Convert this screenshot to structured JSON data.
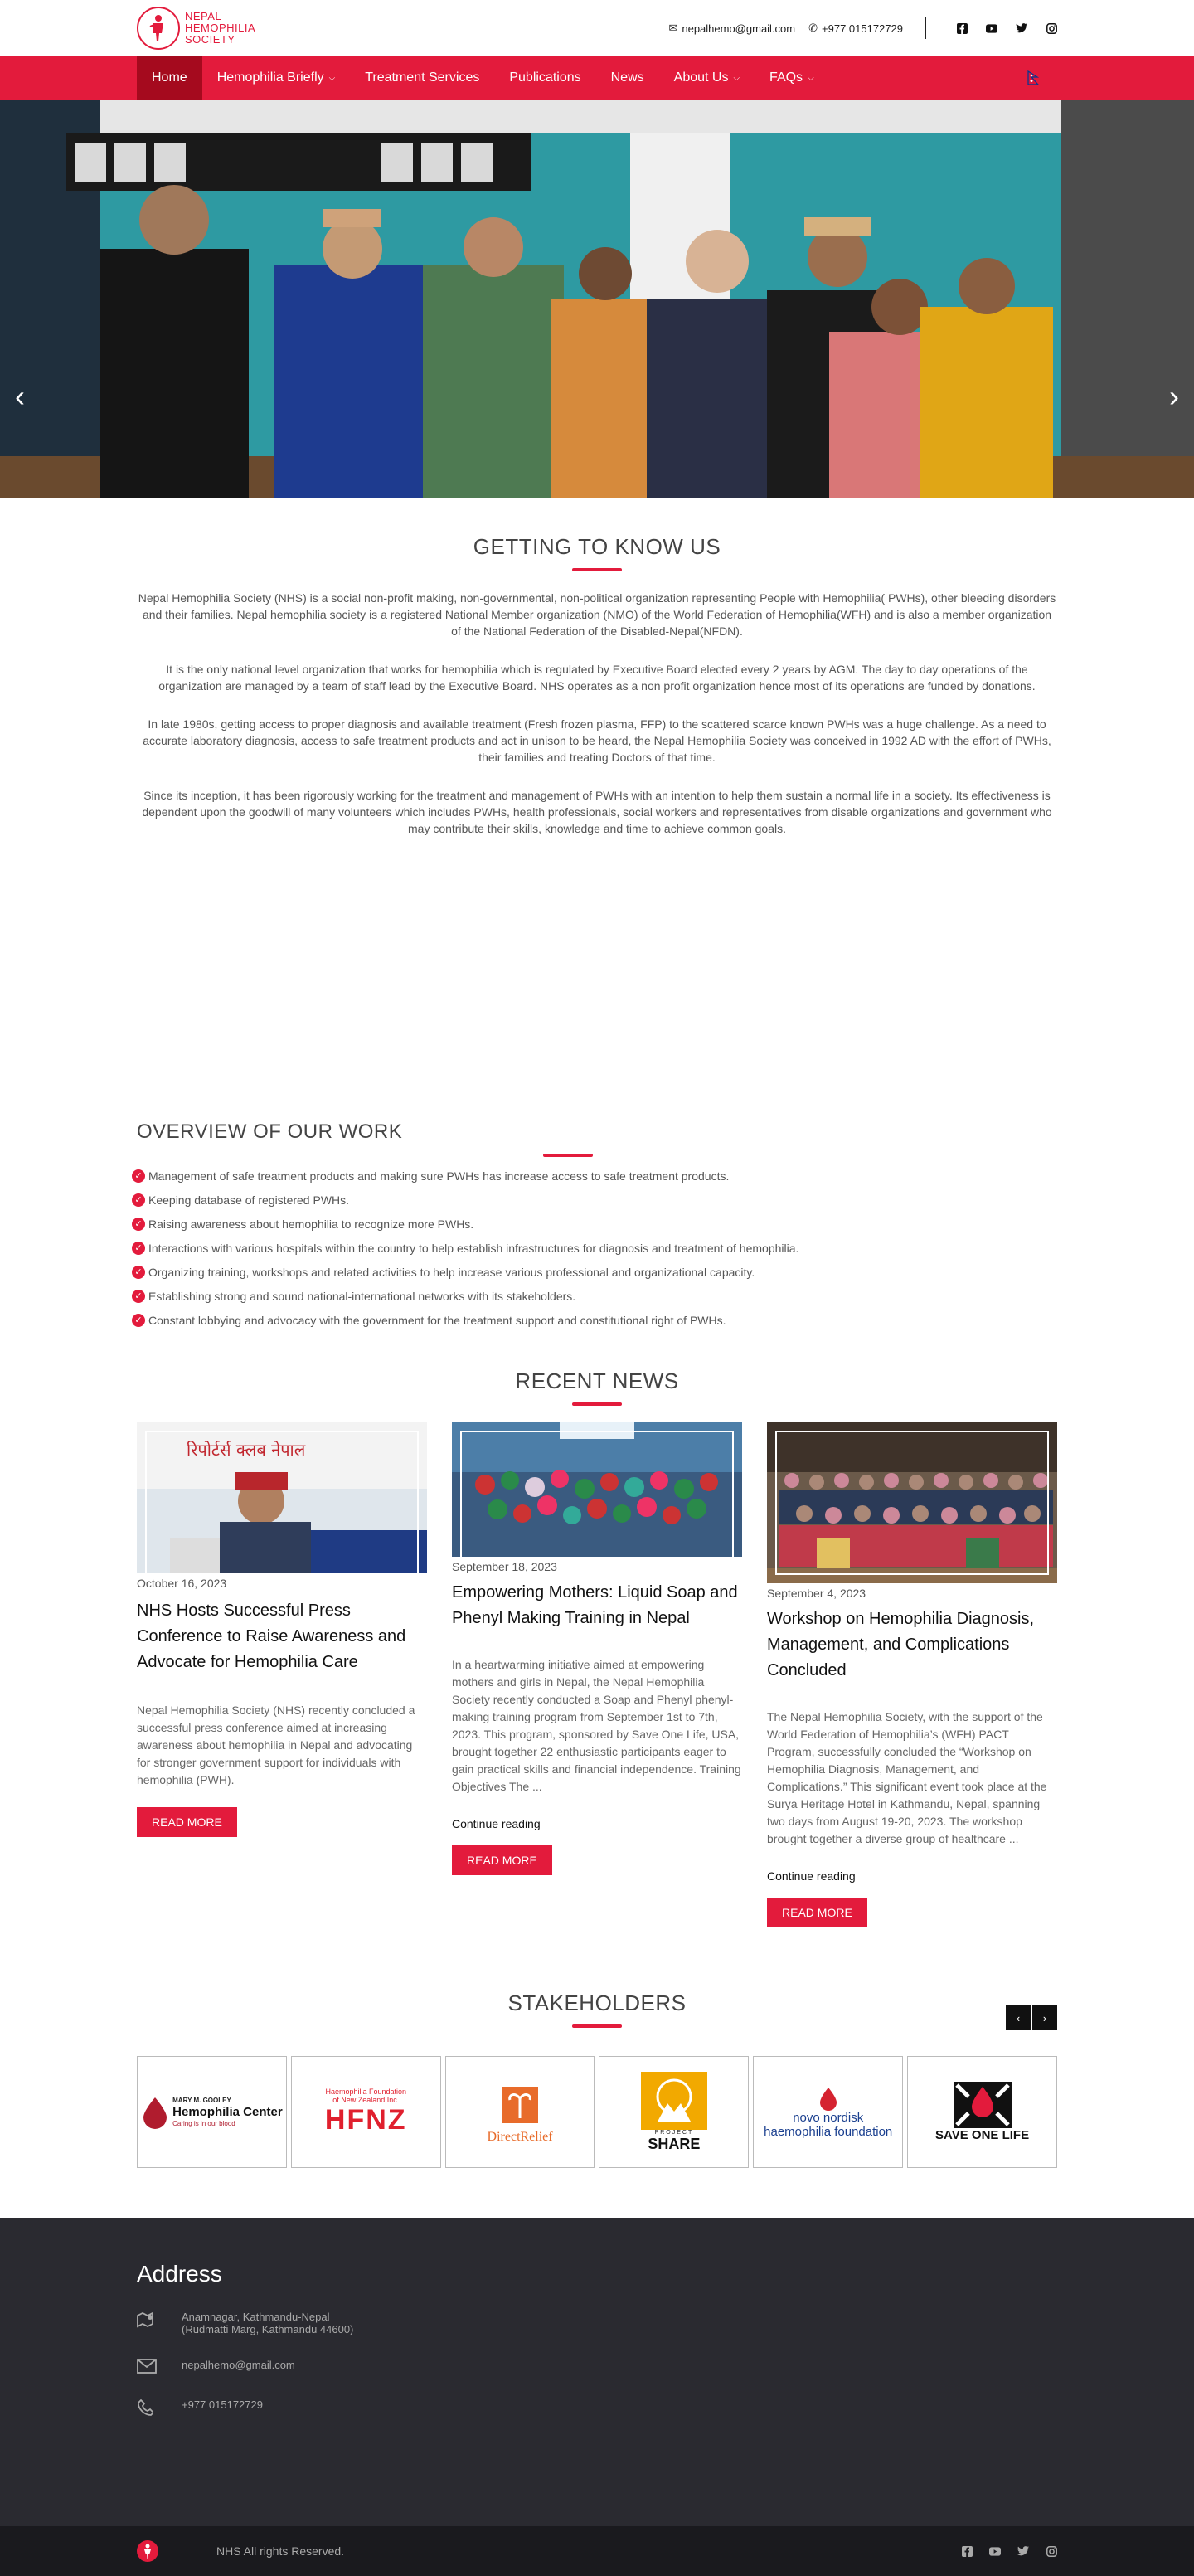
{
  "header": {
    "logo_lines": [
      "NEPAL",
      "HEMOPHILIA",
      "SOCIETY"
    ],
    "email": "nepalhemo@gmail.com",
    "phone": "+977 015172729",
    "social_icons": [
      "facebook-icon",
      "youtube-icon",
      "twitter-icon",
      "instagram-icon"
    ]
  },
  "nav": {
    "items": [
      {
        "label": "Home",
        "active": true
      },
      {
        "label": "Hemophilia Briefly",
        "dropdown": true
      },
      {
        "label": "Treatment Services"
      },
      {
        "label": "Publications"
      },
      {
        "label": "News"
      },
      {
        "label": "About Us",
        "dropdown": true
      },
      {
        "label": "FAQs",
        "dropdown": true
      }
    ]
  },
  "about": {
    "title": "GETTING TO KNOW US",
    "p1": "Nepal Hemophilia Society (NHS) is a social non-profit making, non-governmental, non-political organization representing People with Hemophilia( PWHs), other bleeding disorders and their families. Nepal hemophilia society is a registered National Member organization (NMO) of the World Federation of Hemophilia(WFH) and is also a member organization of the National Federation of the Disabled-Nepal(NFDN).",
    "p2": "It is the only national level organization that works for hemophilia which is regulated by Executive Board elected every 2 years by AGM. The day to day operations of the organization are managed by a team of staff lead by the Executive Board. NHS operates as a non profit organization hence most of its operations are funded by donations.",
    "p3": "In late 1980s, getting access to proper diagnosis and available treatment (Fresh frozen plasma, FFP) to the scattered scarce known PWHs was a huge challenge. As a need to accurate laboratory diagnosis, access to safe treatment products and act in unison to be heard, the Nepal Hemophilia Society was conceived in 1992 AD with the effort of  PWHs, their families and treating Doctors   of that time.",
    "p4": "Since its inception, it has been rigorously working for the treatment and management of PWHs with an intention to help them sustain a normal life in a society. Its effectiveness is dependent upon the goodwill of many volunteers which includes PWHs, health professionals,  social workers and representatives from disable organizations and government who may contribute their skills, knowledge and time to achieve common goals."
  },
  "overview": {
    "title": "OVERVIEW OF OUR WORK",
    "items": [
      "Management of safe treatment products and making sure PWHs has increase access to safe treatment products.",
      "Keeping database of registered PWHs.",
      "Raising awareness about hemophilia to recognize more PWHs.",
      "Interactions with various hospitals within the country to help establish infrastructures for diagnosis and treatment of hemophilia.",
      "Organizing training, workshops and related activities to help increase various professional and organizational capacity.",
      "Establishing strong and sound national-international networks with its stakeholders.",
      "Constant lobbying and advocacy with the government for the treatment support and constitutional right of PWHs."
    ]
  },
  "news": {
    "title": "RECENT NEWS",
    "cards": [
      {
        "date": "October 16, 2023",
        "title": "NHS Hosts Successful Press Conference to Raise Awareness and Advocate for Hemophilia Care",
        "desc": "Nepal Hemophilia Society (NHS) recently concluded a successful press conference aimed at increasing awareness about hemophilia in Nepal and advocating for stronger government support for individuals with hemophilia (PWH).",
        "more": "",
        "button": "READ MORE",
        "image_sign": "रिपोर्टर्स क्लब नेपाल"
      },
      {
        "date": "September 18, 2023",
        "title": "Empowering Mothers: Liquid Soap and Phenyl Making Training in Nepal",
        "desc": "In a heartwarming initiative aimed at empowering mothers and girls in Nepal, the Nepal Hemophilia Society recently conducted a Soap and Phenyl phenyl-making training program from September 1st to 7th, 2023. This program, sponsored by Save One Life, USA, brought together 22 enthusiastic participants eager to gain practical skills and financial independence. Training Objectives The ...",
        "more": "Continue reading",
        "button": "READ MORE"
      },
      {
        "date": "September 4, 2023",
        "title": "Workshop on Hemophilia Diagnosis, Management, and Complications Concluded",
        "desc": "The Nepal Hemophilia Society, with the support of the World Federation of Hemophilia’s (WFH) PACT Program, successfully concluded the “Workshop on Hemophilia Diagnosis, Management, and Complications.” This significant event took place at the Surya Heritage Hotel in Kathmandu, Nepal, spanning two days from August 19-20, 2023. The workshop brought together a diverse group of healthcare ...",
        "more": "Continue reading",
        "button": "READ MORE"
      }
    ]
  },
  "stakeholders": {
    "title": "STAKEHOLDERS",
    "prev": "‹",
    "next": "›",
    "logos": [
      {
        "line1": "MARY M. GOOLEY",
        "line2": "Hemophilia Center",
        "line3": "Caring is in our blood",
        "color": "#b01c2e"
      },
      {
        "line1": "Haemophilia Foundation",
        "line2": "of New Zealand Inc.",
        "line3": "HFNZ",
        "color": "#e0202e"
      },
      {
        "line1": "DirectRelief",
        "color": "#e86b2a"
      },
      {
        "line1": "PROJECT",
        "line2": "SHARE",
        "color": "#f2a900"
      },
      {
        "line1": "novo nordisk",
        "line2": "haemophilia foundation",
        "color": "#1a3f8f"
      },
      {
        "line1": "SAVE ONE LIFE",
        "color": "#111111"
      }
    ]
  },
  "footer": {
    "title": "Address",
    "address_line1": "Anamnagar, Kathmandu-Nepal",
    "address_line2": "(Rudmatti Marg, Kathmandu 44600)",
    "email": "nepalhemo@gmail.com",
    "phone": "+977 015172729",
    "copyright": "NHS All rights Reserved."
  },
  "colors": {
    "brand": "#e31b3c",
    "nav_active": "#a50a1e",
    "footer_bg": "#2a2a30"
  }
}
